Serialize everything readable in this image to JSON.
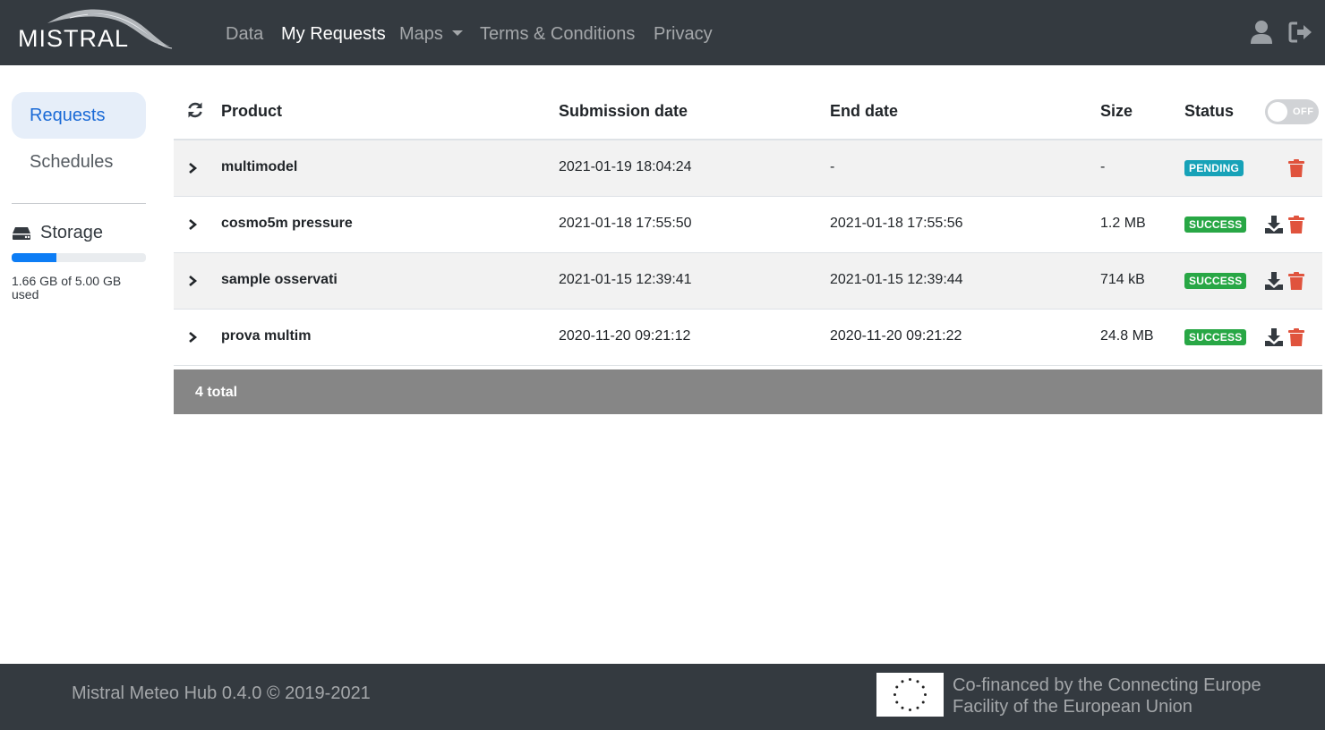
{
  "app": {
    "logo_text": "MISTRAL"
  },
  "nav": {
    "items": [
      {
        "label": "Data"
      },
      {
        "label": "My Requests"
      },
      {
        "label": "Maps"
      },
      {
        "label": "Terms & Conditions"
      },
      {
        "label": "Privacy"
      }
    ],
    "active": "My Requests",
    "icons": [
      "user-icon",
      "logout-icon"
    ]
  },
  "sidebar": {
    "items": [
      {
        "label": "Requests",
        "active": true
      },
      {
        "label": "Schedules",
        "active": false
      }
    ],
    "storage": {
      "label": "Storage",
      "used_fraction": 0.332,
      "text": "1.66 GB of 5.00 GB used"
    }
  },
  "table": {
    "headers": {
      "product": "Product",
      "submission": "Submission date",
      "end": "End date",
      "size": "Size",
      "status": "Status"
    },
    "toggle": {
      "label": "OFF",
      "on": false
    },
    "rows": [
      {
        "product": "multimodel",
        "submission": "2021-01-19 18:04:24",
        "end": "-",
        "size": "-",
        "status": "PENDING",
        "download": false
      },
      {
        "product": "cosmo5m pressure",
        "submission": "2021-01-18 17:55:50",
        "end": "2021-01-18 17:55:56",
        "size": "1.2 MB",
        "status": "SUCCESS",
        "download": true
      },
      {
        "product": "sample osservati",
        "submission": "2021-01-15 12:39:41",
        "end": "2021-01-15 12:39:44",
        "size": "714 kB",
        "status": "SUCCESS",
        "download": true
      },
      {
        "product": "prova multim",
        "submission": "2020-11-20 09:21:12",
        "end": "2020-11-20 09:21:22",
        "size": "24.8 MB",
        "status": "SUCCESS",
        "download": true
      }
    ],
    "total": "4 total"
  },
  "footer": {
    "copyright": "Mistral Meteo Hub 0.4.0 © 2019-2021",
    "eu_line1": "Co-financed by the Connecting Europe",
    "eu_line2": "Facility of the European Union"
  },
  "colors": {
    "navbar": "#343a40",
    "accent": "#1a6ad6",
    "pending": "#17a2b8",
    "success": "#28a745",
    "delete": "#e0533d"
  }
}
